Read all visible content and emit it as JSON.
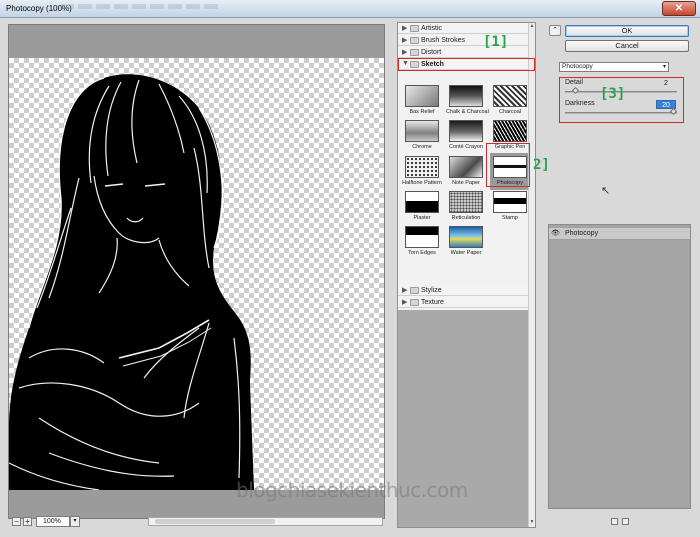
{
  "window": {
    "title": "Photocopy (100%)",
    "close_glyph": "✕"
  },
  "preview": {
    "zoom": "100%",
    "zoom_minus": "−",
    "zoom_plus": "+",
    "zoom_dropdown": "▾"
  },
  "gallery": {
    "categories_top": [
      {
        "label": "Artistic",
        "expanded": false
      },
      {
        "label": "Brush Strokes",
        "expanded": false
      },
      {
        "label": "Distort",
        "expanded": false
      },
      {
        "label": "Sketch",
        "expanded": true
      }
    ],
    "sketch_filters": [
      "Bas Relief",
      "Chalk & Charcoal",
      "Charcoal",
      "Chrome",
      "Conté Crayon",
      "Graphic Pen",
      "Halftone Pattern",
      "Note Paper",
      "Photocopy",
      "Plaster",
      "Reticulation",
      "Stamp",
      "Torn Edges",
      "Water Paper"
    ],
    "selected_filter": "Photocopy",
    "categories_bottom": [
      {
        "label": "Stylize",
        "expanded": false
      },
      {
        "label": "Texture",
        "expanded": false
      }
    ]
  },
  "panel": {
    "ok_label": "OK",
    "cancel_label": "Cancel",
    "filter_select_value": "Photocopy",
    "params": [
      {
        "label": "Detail",
        "value": "2",
        "fraction": 0.08
      },
      {
        "label": "Darkness",
        "value": "20",
        "fraction": 1.0
      }
    ],
    "effect_layer": "Photocopy"
  },
  "annotations": {
    "one": "[1]",
    "two": "2]",
    "three": "[3]"
  },
  "watermark": "blogchiasekienthuc.com",
  "colors": {
    "annotation_box": "#d32a2a",
    "annotation_text": "#2aa24a",
    "ok_focus": "#3d7ab8"
  }
}
